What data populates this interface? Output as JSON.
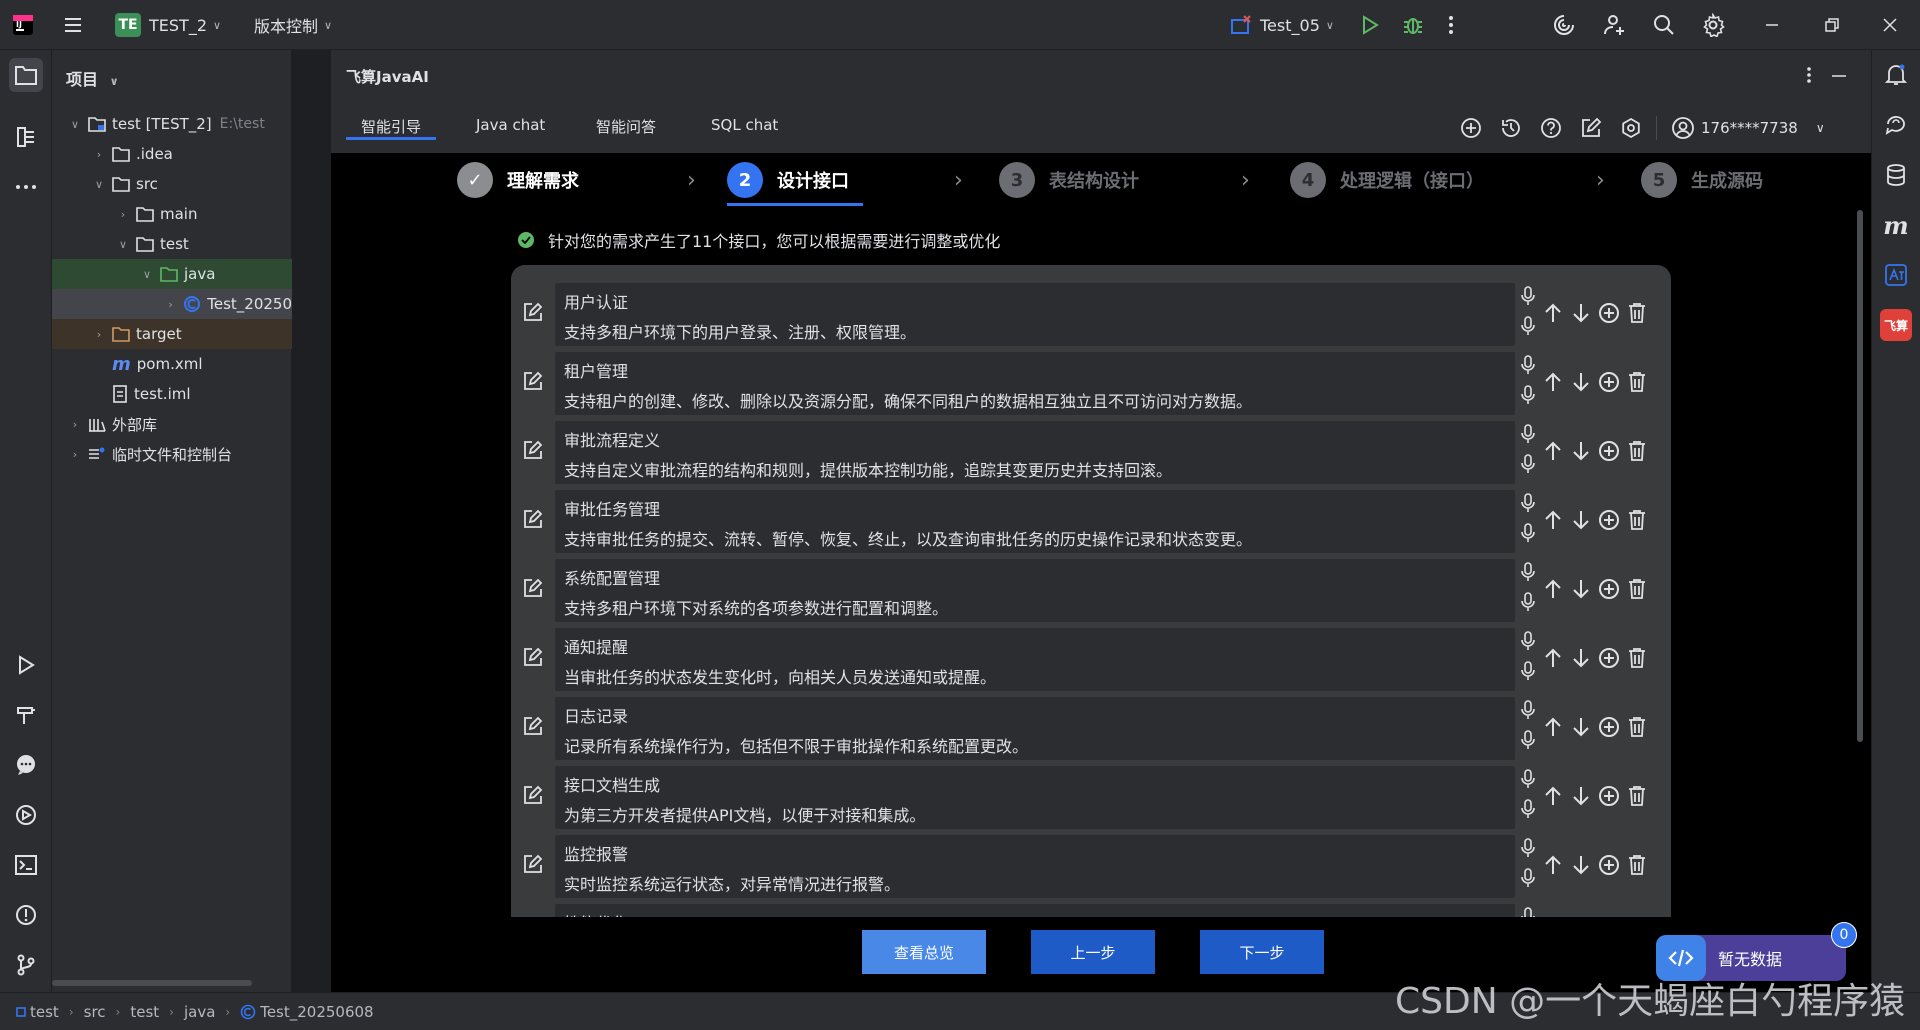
{
  "titlebar": {
    "project_badge": "TE",
    "project_name": "TEST_2",
    "vcs_menu": "版本控制",
    "run_config": "Test_05"
  },
  "project_panel": {
    "title": "项目",
    "tree": [
      {
        "label": "test [TEST_2]",
        "hint": "E:\\test"
      },
      {
        "label": ".idea"
      },
      {
        "label": "src"
      },
      {
        "label": "main"
      },
      {
        "label": "test"
      },
      {
        "label": "java"
      },
      {
        "label": "Test_20250"
      },
      {
        "label": "target"
      },
      {
        "label": "pom.xml"
      },
      {
        "label": "test.iml"
      },
      {
        "label": "外部库"
      },
      {
        "label": "临时文件和控制台"
      }
    ]
  },
  "plugin": {
    "title": "飞算JavaAI",
    "tabs": [
      "智能引导",
      "Java chat",
      "智能问答",
      "SQL chat"
    ],
    "account": "176****7738",
    "steps": [
      {
        "num": "✓",
        "label": "理解需求"
      },
      {
        "num": "2",
        "label": "设计接口"
      },
      {
        "num": "3",
        "label": "表结构设计"
      },
      {
        "num": "4",
        "label": "处理逻辑（接口）"
      },
      {
        "num": "5",
        "label": "生成源码"
      }
    ],
    "notice": "针对您的需求产生了11个接口，您可以根据需要进行调整或优化",
    "interfaces": [
      {
        "name": "用户认证",
        "desc": "支持多租户环境下的用户登录、注册、权限管理。"
      },
      {
        "name": "租户管理",
        "desc": "支持租户的创建、修改、删除以及资源分配，确保不同租户的数据相互独立且不可访问对方数据。"
      },
      {
        "name": "审批流程定义",
        "desc": "支持自定义审批流程的结构和规则，提供版本控制功能，追踪其变更历史并支持回滚。"
      },
      {
        "name": "审批任务管理",
        "desc": "支持审批任务的提交、流转、暂停、恢复、终止，以及查询审批任务的历史操作记录和状态变更。"
      },
      {
        "name": "系统配置管理",
        "desc": "支持多租户环境下对系统的各项参数进行配置和调整。"
      },
      {
        "name": "通知提醒",
        "desc": "当审批任务的状态发生变化时，向相关人员发送通知或提醒。"
      },
      {
        "name": "日志记录",
        "desc": "记录所有系统操作行为，包括但不限于审批操作和系统配置更改。"
      },
      {
        "name": "接口文档生成",
        "desc": "为第三方开发者提供API文档，以便于对接和集成。"
      },
      {
        "name": "监控报警",
        "desc": "实时监控系统运行状态，对异常情况进行报警。"
      },
      {
        "name": "性能优化",
        "desc": ""
      }
    ],
    "buttons": {
      "overview": "查看总览",
      "prev": "上一步",
      "next": "下一步"
    },
    "nodata_label": "暂无数据",
    "nodata_count": "0"
  },
  "statusbar": {
    "crumbs": [
      "test",
      "src",
      "test",
      "java",
      "Test_20250608"
    ]
  },
  "watermark": "CSDN @一个天蝎座白勺程序猿",
  "colors": {
    "accent": "#3574f0",
    "success": "#5fb865",
    "brand_red": "#e0403a"
  }
}
